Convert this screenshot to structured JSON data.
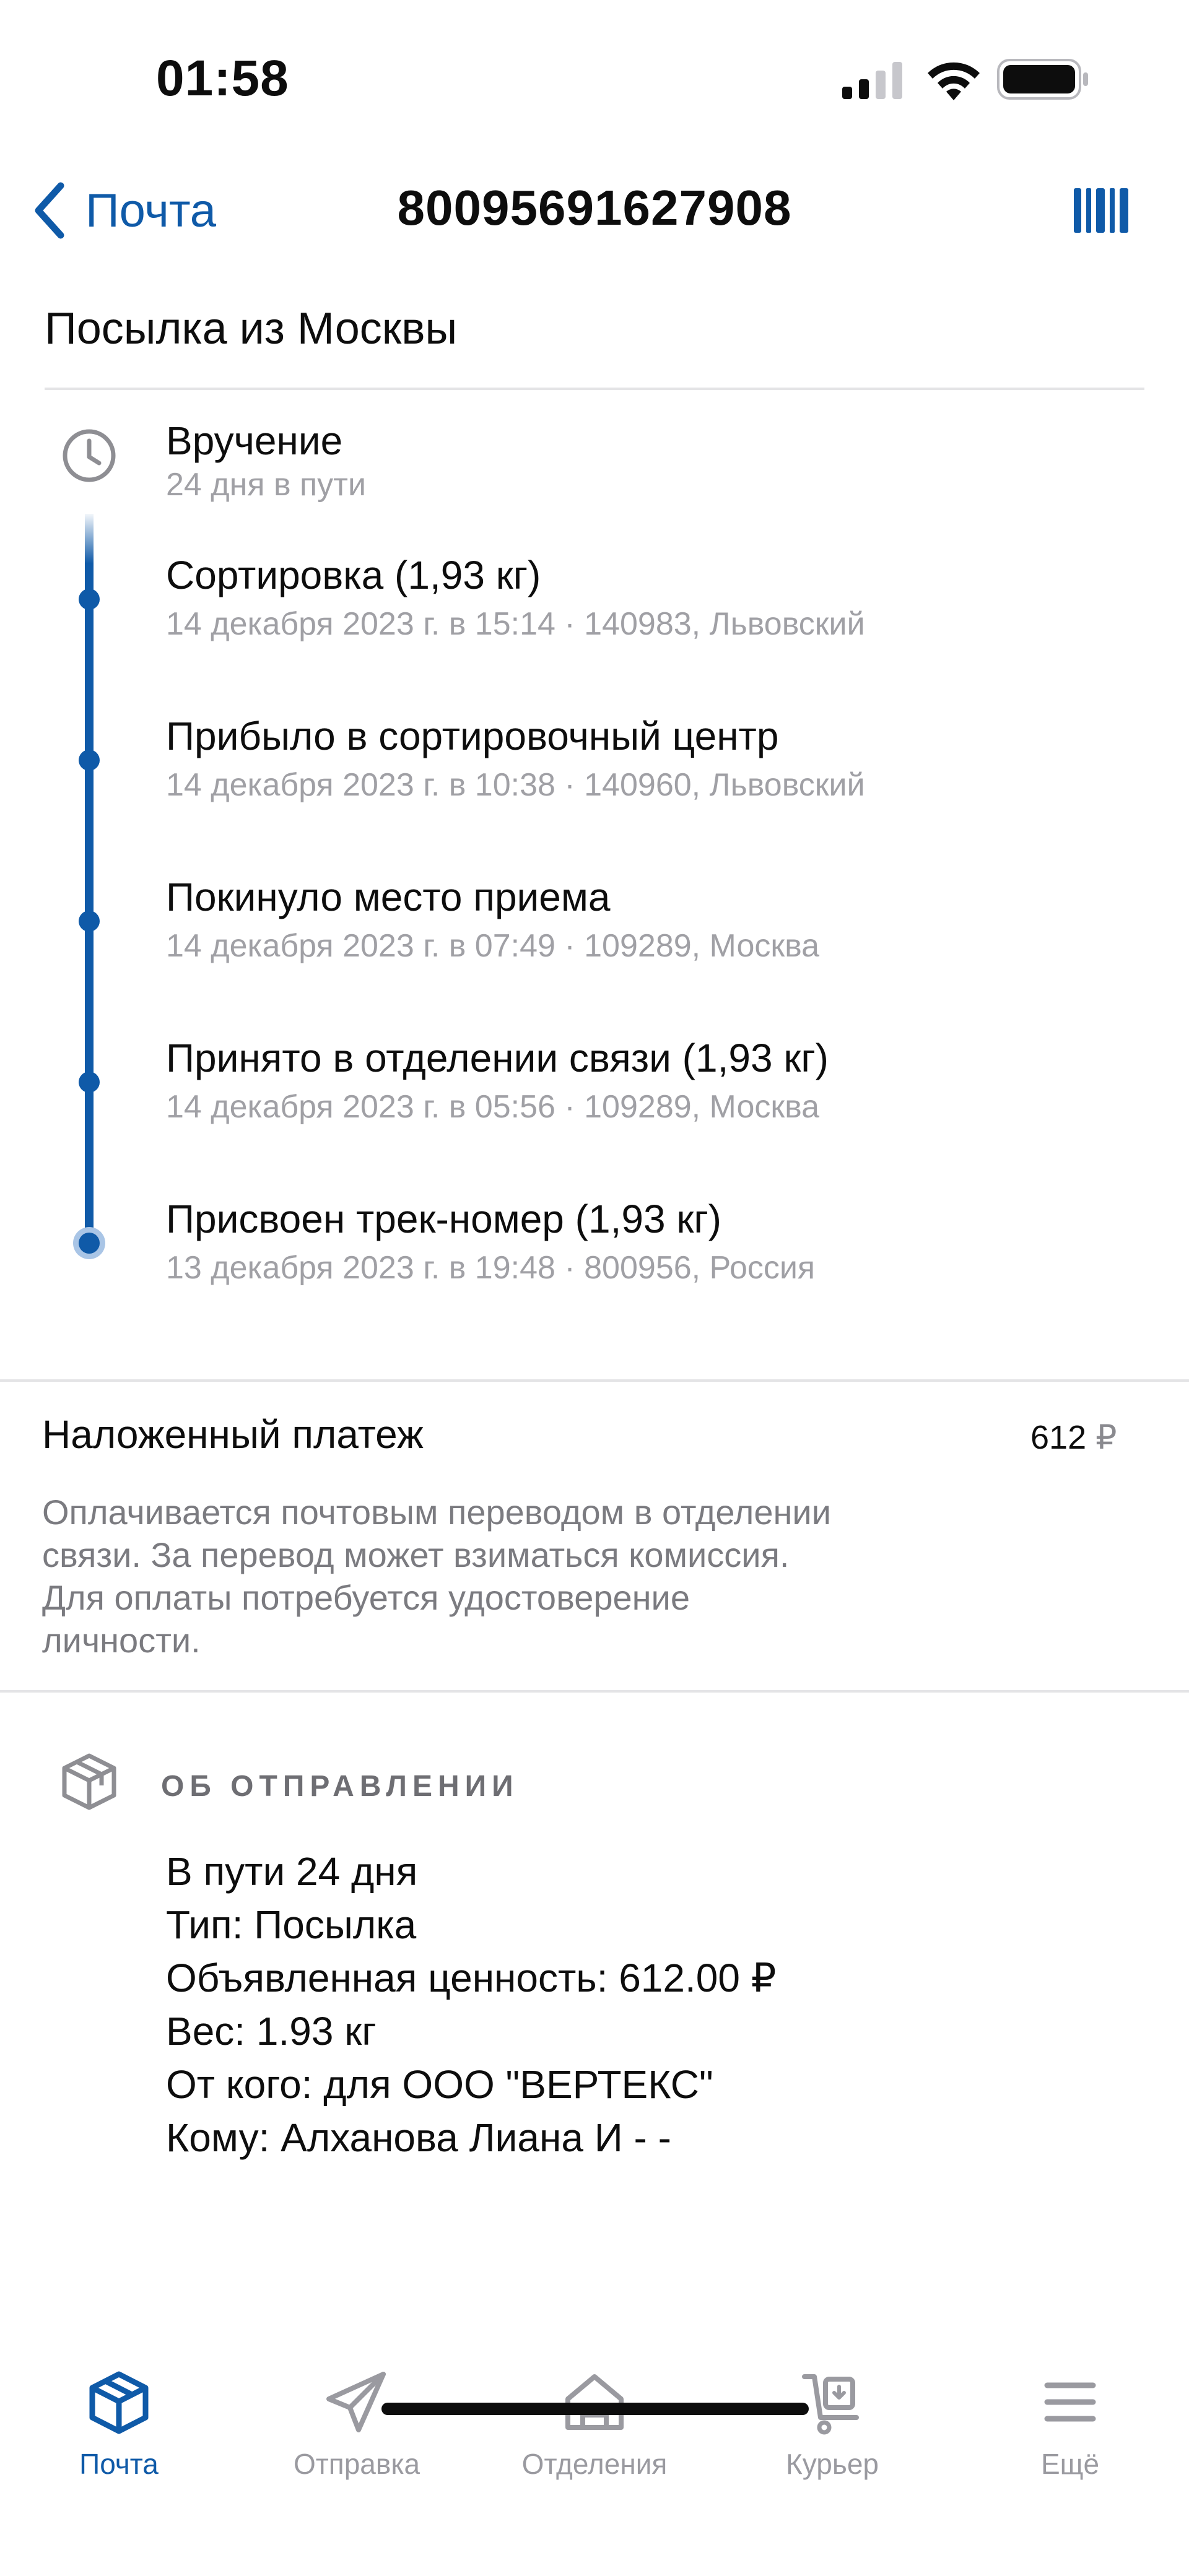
{
  "status_bar": {
    "time": "01:58"
  },
  "nav": {
    "back_label": "Почта",
    "title": "80095691627908"
  },
  "parcel": {
    "title": "Посылка из Москвы"
  },
  "timeline": {
    "current": {
      "title": "Вручение",
      "subtitle": "24 дня в пути"
    },
    "events": [
      {
        "title": "Сортировка  (1,93 кг)",
        "subtitle": "14 декабря 2023 г. в 15:14 · 140983, Львовский"
      },
      {
        "title": "Прибыло в сортировочный центр",
        "subtitle": "14 декабря 2023 г. в 10:38 · 140960, Львовский"
      },
      {
        "title": "Покинуло место приема",
        "subtitle": "14 декабря 2023 г. в 07:49 · 109289, Москва"
      },
      {
        "title": "Принято в отделении связи  (1,93 кг)",
        "subtitle": "14 декабря 2023 г. в 05:56 · 109289, Москва"
      },
      {
        "title": "Присвоен трек-номер  (1,93 кг)",
        "subtitle": "13 декабря 2023 г. в 19:48 · 800956, Россия"
      }
    ]
  },
  "payment": {
    "title": "Наложенный платеж",
    "amount": "612",
    "currency": "₽",
    "description_lines": [
      "Оплачивается почтовым переводом в отделении",
      "связи. За перевод может взиматься комиссия.",
      "Для оплаты потребуется удостоверение",
      "личности."
    ]
  },
  "shipment_info": {
    "heading": "ОБ ОТПРАВЛЕНИИ",
    "lines": [
      "В пути 24 дня",
      "Тип: Посылка",
      "Объявленная ценность: 612.00 ₽",
      "Вес: 1.93 кг",
      "От кого: для ООО \"ВЕРТЕКС\"",
      "Кому: Алханова Лиана И - -"
    ]
  },
  "tabs": [
    {
      "label": "Почта",
      "icon": "box-icon",
      "active": true
    },
    {
      "label": "Отправка",
      "icon": "paper-plane-icon",
      "active": false
    },
    {
      "label": "Отделения",
      "icon": "post-office-icon",
      "active": false
    },
    {
      "label": "Курьер",
      "icon": "courier-cart-icon",
      "active": false
    },
    {
      "label": "Ещё",
      "icon": "menu-icon",
      "active": false
    }
  ],
  "colors": {
    "accent": "#0f5aa8",
    "text": "#0d0d0d",
    "secondary_text": "#a0a0a5",
    "divider": "#e4e4e6"
  }
}
